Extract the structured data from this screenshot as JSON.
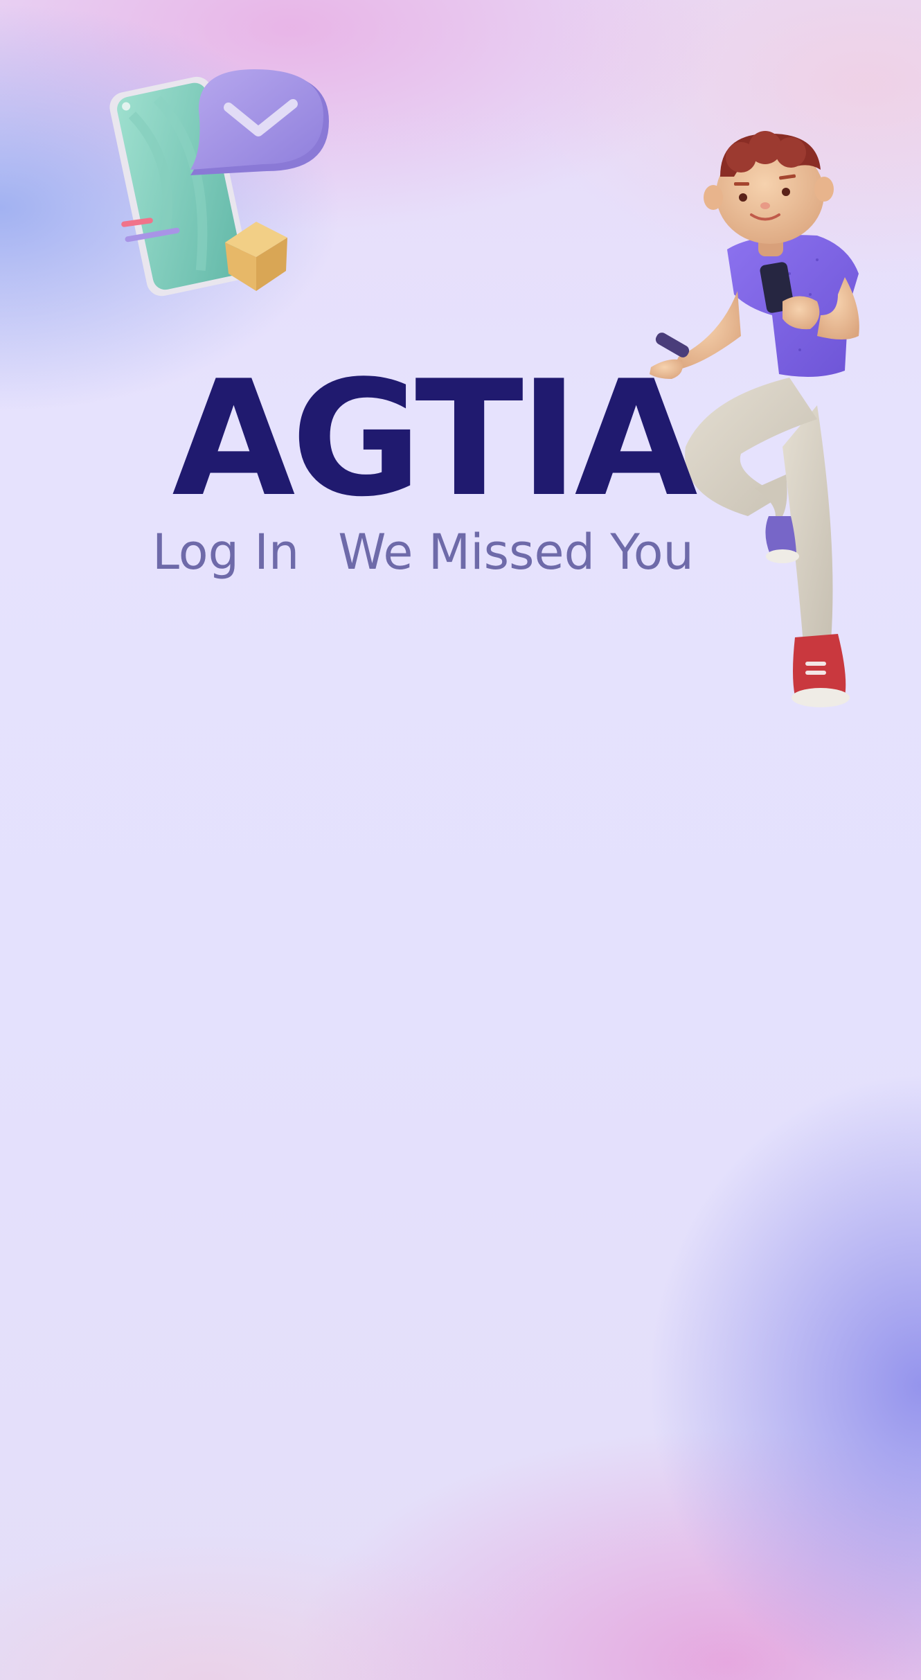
{
  "app": {
    "brand_name": "AGTIA"
  },
  "login_header": {
    "label": "Log In",
    "tagline": "We Missed You"
  },
  "illustrations": {
    "left": "phone-with-check-bubble-and-box",
    "right": "person-holding-phone-3d-character"
  },
  "colors": {
    "brand": "#201a6f",
    "subtitle": "#6e6aa9",
    "background": "#e6e2fd"
  }
}
